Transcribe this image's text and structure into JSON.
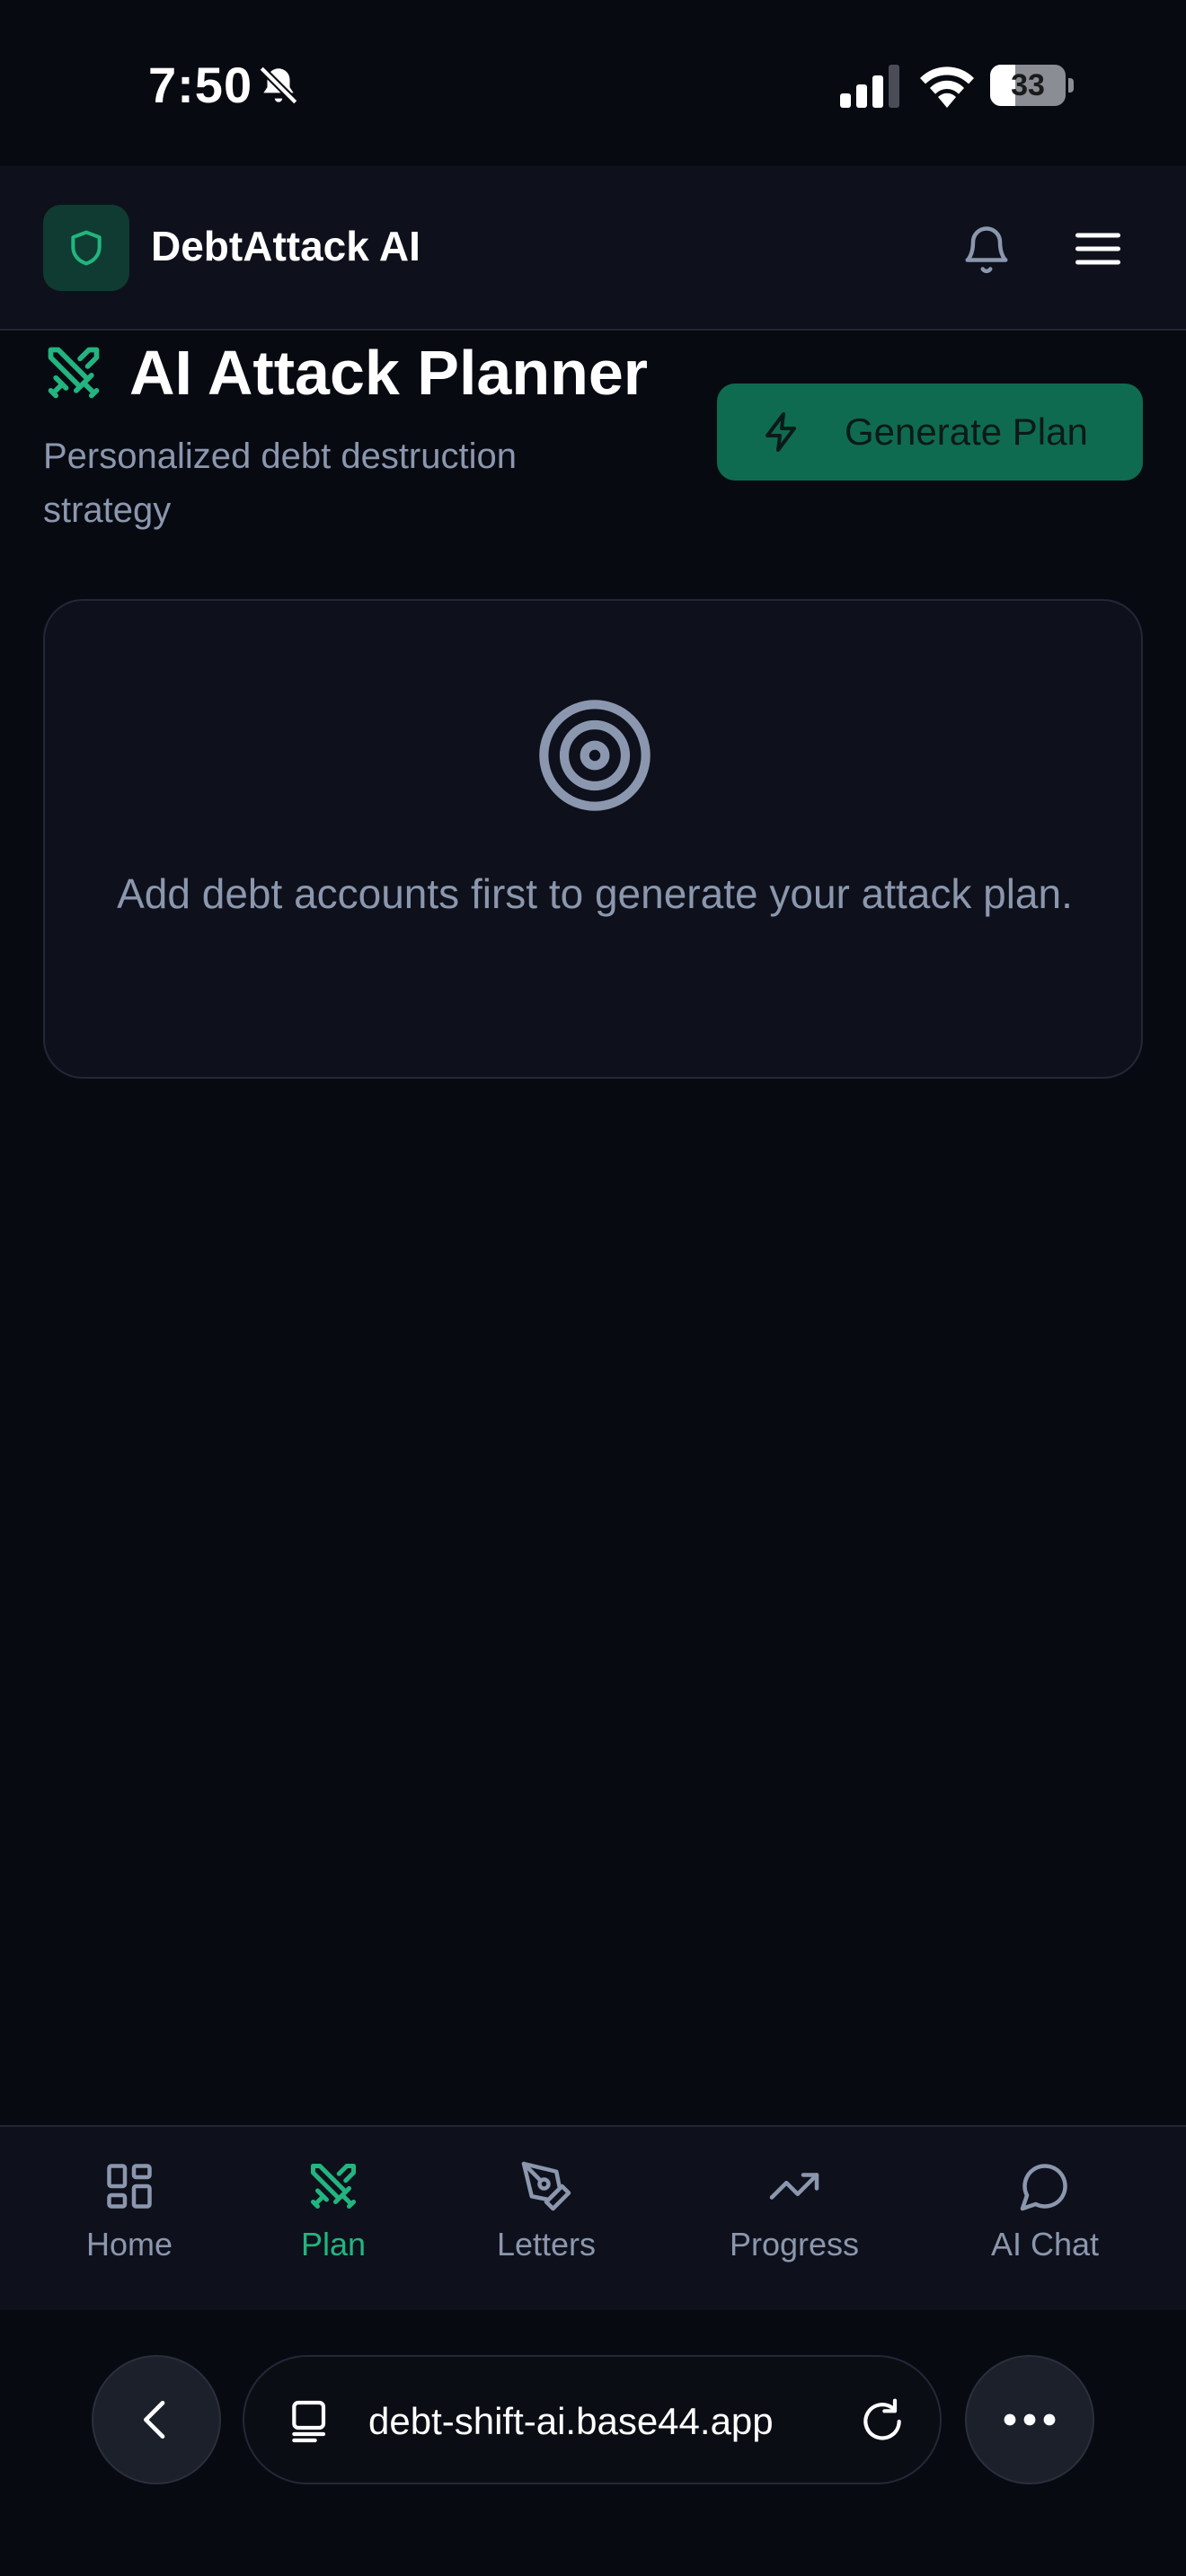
{
  "status_bar": {
    "time": "7:50",
    "battery_level": "33",
    "battery_fraction": 0.33
  },
  "header": {
    "app_name": "DebtAttack AI",
    "logo_icon": "shield-icon",
    "notifications_icon": "bell-icon",
    "menu_icon": "hamburger-menu-icon"
  },
  "planner": {
    "title": "AI Attack Planner",
    "title_icon": "crossed-swords-icon",
    "subtitle": "Personalized debt destruction strategy",
    "generate_button": "Generate Plan",
    "generate_icon": "lightning-bolt-icon"
  },
  "empty_state": {
    "icon": "target-icon",
    "message": "Add debt accounts first to generate your attack plan."
  },
  "bottom_nav": {
    "items": [
      {
        "label": "Home",
        "icon": "dashboard-grid-icon",
        "active": false
      },
      {
        "label": "Plan",
        "icon": "crossed-swords-icon",
        "active": true
      },
      {
        "label": "Letters",
        "icon": "pen-nib-icon",
        "active": false
      },
      {
        "label": "Progress",
        "icon": "trending-up-icon",
        "active": false
      },
      {
        "label": "AI Chat",
        "icon": "chat-bubble-icon",
        "active": false
      }
    ]
  },
  "browser": {
    "url": "debt-shift-ai.base44.app",
    "back_icon": "chevron-left-icon",
    "tabs_icon": "tabs-icon",
    "reload_icon": "reload-icon",
    "more_icon": "ellipsis-icon"
  },
  "colors": {
    "background": "#080a12",
    "surface": "#0e111b",
    "accent": "#22b57f",
    "button_bg": "#0f6b4f",
    "muted_text": "#8b97ae"
  }
}
